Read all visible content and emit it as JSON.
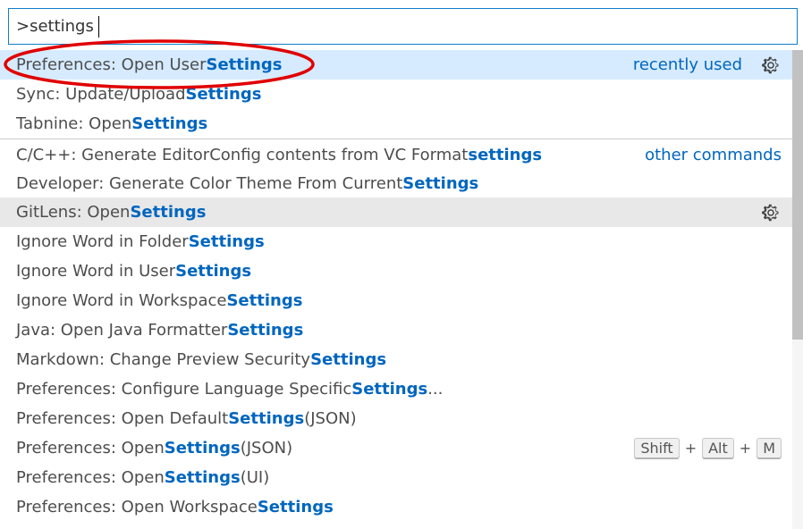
{
  "search": {
    "value": ">settings"
  },
  "rows": [
    {
      "prefix": "Preferences: Open User ",
      "highlight": "Settings",
      "suffix": ""
    },
    {
      "prefix": "Sync: Update/Upload ",
      "highlight": "Settings",
      "suffix": ""
    },
    {
      "prefix": "Tabnine: Open ",
      "highlight": "Settings",
      "suffix": ""
    },
    {
      "prefix": "C/C++: Generate EditorConfig contents from VC Format ",
      "highlight": "settings",
      "suffix": ""
    },
    {
      "prefix": "Developer: Generate Color Theme From Current ",
      "highlight": "Settings",
      "suffix": ""
    },
    {
      "prefix": "GitLens: Open ",
      "highlight": "Settings",
      "suffix": ""
    },
    {
      "prefix": "Ignore Word in Folder ",
      "highlight": "Settings",
      "suffix": ""
    },
    {
      "prefix": "Ignore Word in User ",
      "highlight": "Settings",
      "suffix": ""
    },
    {
      "prefix": "Ignore Word in Workspace ",
      "highlight": "Settings",
      "suffix": ""
    },
    {
      "prefix": "Java: Open Java Formatter ",
      "highlight": "Settings",
      "suffix": ""
    },
    {
      "prefix": "Markdown: Change Preview Security ",
      "highlight": "Settings",
      "suffix": ""
    },
    {
      "prefix": "Preferences: Configure Language Specific ",
      "highlight": "Settings",
      "suffix": "..."
    },
    {
      "prefix": "Preferences: Open Default ",
      "highlight": "Settings",
      "suffix": " (JSON)"
    },
    {
      "prefix": "Preferences: Open ",
      "highlight": "Settings",
      "suffix": " (JSON)"
    },
    {
      "prefix": "Preferences: Open ",
      "highlight": "Settings",
      "suffix": " (UI)"
    },
    {
      "prefix": "Preferences: Open Workspace ",
      "highlight": "Settings",
      "suffix": ""
    }
  ],
  "groups": {
    "recently_used": "recently used",
    "other_commands": "other commands"
  },
  "keybinding": {
    "keys": [
      "Shift",
      "Alt",
      "M"
    ],
    "plus": "+"
  },
  "icons": {
    "gear": "gear-icon"
  },
  "colors": {
    "highlight": "#0066bf",
    "selected_bg": "#d6ebff",
    "hover_bg": "#e8e8e8",
    "focus_border": "#0f7fc7",
    "annotation": "#e00000"
  }
}
